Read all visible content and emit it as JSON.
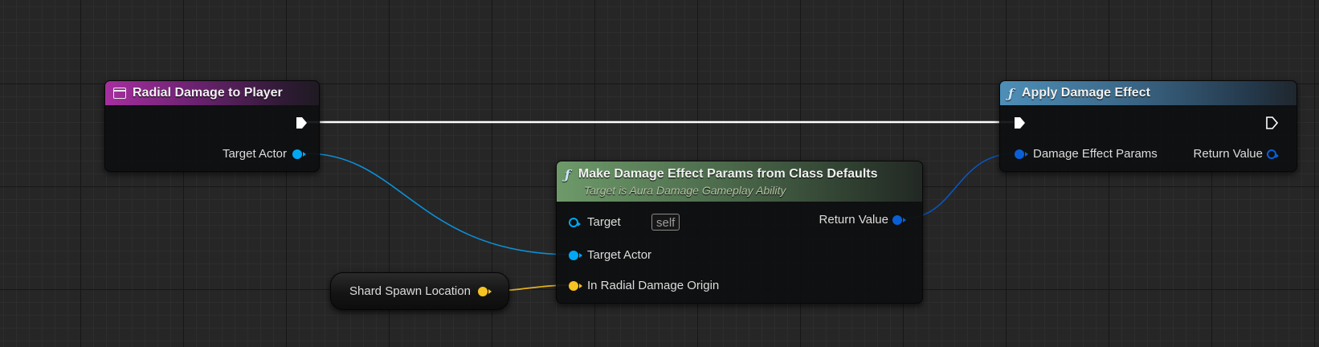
{
  "colors": {
    "object_pin": "#00a8f3",
    "struct_pin": "#0a5fd6",
    "vector_pin": "#f7c322",
    "exec_pin": "#ffffff"
  },
  "nodes": {
    "radial_event": {
      "title": "Radial Damage to Player",
      "icon": "event-icon",
      "outputs": {
        "target_actor_label": "Target Actor"
      }
    },
    "make_params": {
      "title": "Make Damage Effect Params from Class Defaults",
      "subtitle": "Target is Aura Damage Gameplay Ability",
      "icon": "function-icon",
      "inputs": {
        "target_label": "Target",
        "target_value": "self",
        "target_actor_label": "Target Actor",
        "origin_label": "In Radial Damage Origin"
      },
      "outputs": {
        "return_value_label": "Return Value"
      }
    },
    "apply_damage": {
      "title": "Apply Damage Effect",
      "icon": "function-icon",
      "inputs": {
        "params_label": "Damage Effect Params"
      },
      "outputs": {
        "return_value_label": "Return Value"
      }
    },
    "shard_spawn": {
      "label": "Shard Spawn Location"
    }
  }
}
